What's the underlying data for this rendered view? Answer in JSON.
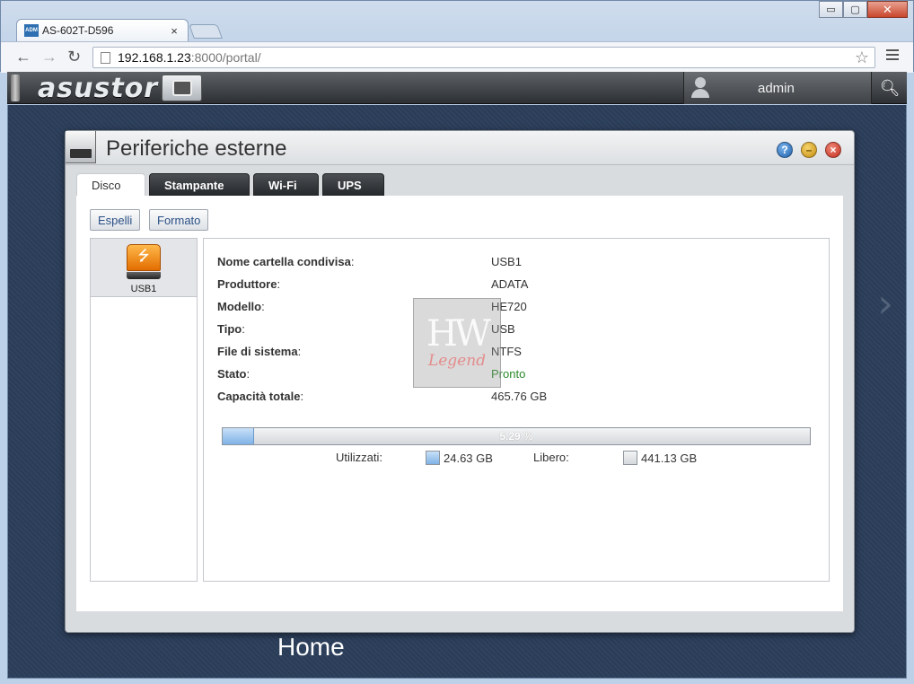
{
  "browser": {
    "tab_title": "AS-602T-D596",
    "tab_favicon_text": "ADM",
    "tab_close": "×",
    "url_host": "192.168.1.23",
    "url_rest": ":8000/portal/",
    "win_min": "▭",
    "win_max": "▢",
    "win_close": "✕"
  },
  "appbar": {
    "logo": "asustor",
    "username": "admin"
  },
  "window": {
    "title": "Periferiche esterne",
    "help": "?",
    "minimize": "–",
    "close": "×"
  },
  "tabs": [
    {
      "label": "Disco"
    },
    {
      "label": "Stampante"
    },
    {
      "label": "Wi-Fi"
    },
    {
      "label": "UPS"
    }
  ],
  "buttons": {
    "eject": "Espelli",
    "format": "Formato"
  },
  "devices": [
    {
      "label": "USB1",
      "icon": "usb-drive-icon"
    }
  ],
  "details": [
    {
      "label": "Nome cartella condivisa",
      "value": "USB1"
    },
    {
      "label": "Produttore",
      "value": "ADATA"
    },
    {
      "label": "Modello",
      "value": "HE720"
    },
    {
      "label": "Tipo",
      "value": "USB"
    },
    {
      "label": "File di sistema",
      "value": "NTFS"
    },
    {
      "label": "Stato",
      "value": "Pronto"
    },
    {
      "label": "Capacità totale",
      "value": "465.76 GB"
    }
  ],
  "usage": {
    "percent_text": "5.29 %",
    "percent": 5.29,
    "used_label": "Utilizzati:",
    "used_value": "24.63 GB",
    "free_label": "Libero:",
    "free_value": "441.13 GB"
  },
  "watermark": {
    "line1": "HW",
    "line2": "Legend"
  },
  "desktop": {
    "home_label": "Home",
    "next_arrow": "›"
  },
  "colors": {
    "status_ok": "#2a8a2a",
    "usage_fill": "#7fb2e6"
  }
}
